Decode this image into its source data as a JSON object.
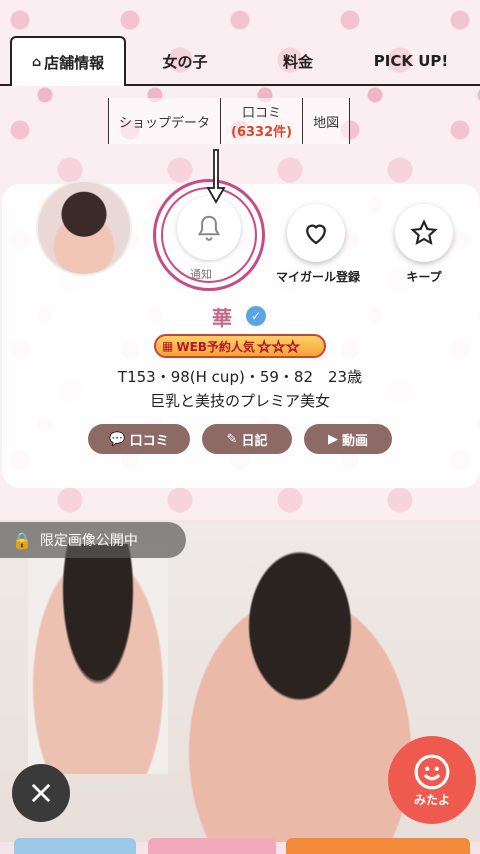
{
  "tabs": [
    {
      "label": "店舗情報",
      "icon": "home-icon"
    },
    {
      "label": "女の子"
    },
    {
      "label": "料金"
    },
    {
      "label": "PICK UP!"
    }
  ],
  "subnav": {
    "shop_data": "ショップデータ",
    "reviews": "口コミ",
    "reviews_count": "(6332件)",
    "map": "地図"
  },
  "actions": {
    "notify": "通知",
    "my_girl": "マイガール登録",
    "keep": "キープ"
  },
  "profile": {
    "name": "華",
    "rank_label": "WEB予約人気",
    "stars": "☆☆☆",
    "stats": "T153・98(H cup)・59・82　23歳",
    "catchcopy": "巨乳と美技のプレミア美女"
  },
  "pills": {
    "reviews": "口コミ",
    "diary": "日記",
    "video": "動画"
  },
  "photo": {
    "lock_text": "限定画像公開中"
  },
  "floating": {
    "mitayo": "みたよ"
  },
  "colors": {
    "accent_pink": "#c84a86",
    "count_red": "#d64a2c",
    "pill_brown": "#8e6a66",
    "mitayo_red": "#ef5a4e"
  }
}
